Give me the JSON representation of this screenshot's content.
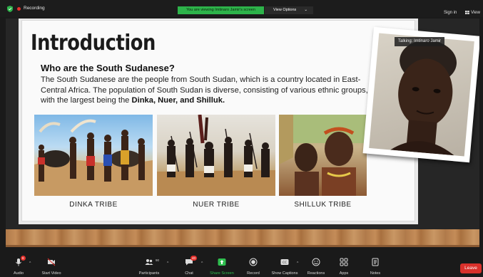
{
  "meeting": {
    "recording_label": "Recording",
    "viewing_banner": "You are viewing Imtinaro Jamir's screen",
    "view_options": "View Options",
    "sign_in": "Sign in",
    "view": "View"
  },
  "slide": {
    "title": "Introduction",
    "subtitle": "Who are the South Sudanese?",
    "body_plain": "The South Sudanese are the people from South Sudan, which is a country located in East-Central Africa. The population of South Sudan is diverse, consisting of various ethnic groups, with the largest being the ",
    "body_bold": "Dinka, Nuer, and Shilluk.",
    "captions": [
      "DINKA TRIBE",
      "NUER TRIBE",
      "SHILLUK TRIBE"
    ]
  },
  "speaker": {
    "label": "Talking: Imtinaro Jamir"
  },
  "toolbar": {
    "audio": "Audio",
    "audio_badge": "8",
    "video": "Start Video",
    "participants": "Participants",
    "participants_count": "90",
    "chat": "Chat",
    "chat_badge": "40",
    "share": "Share Screen",
    "record": "Record",
    "captions": "Show Captions",
    "reactions": "Reactions",
    "apps": "Apps",
    "notes": "Notes",
    "leave": "Leave"
  },
  "colors": {
    "banner_green": "#2db34a",
    "leave_red": "#d9302b",
    "recording_red": "#e5322d"
  },
  "icons": [
    "shield-icon",
    "recording-dot-icon",
    "grid-view-icon",
    "microphone-icon",
    "video-off-icon",
    "participants-icon",
    "chat-icon",
    "share-screen-icon",
    "record-icon",
    "captions-icon",
    "reactions-icon",
    "apps-icon",
    "notes-icon"
  ]
}
